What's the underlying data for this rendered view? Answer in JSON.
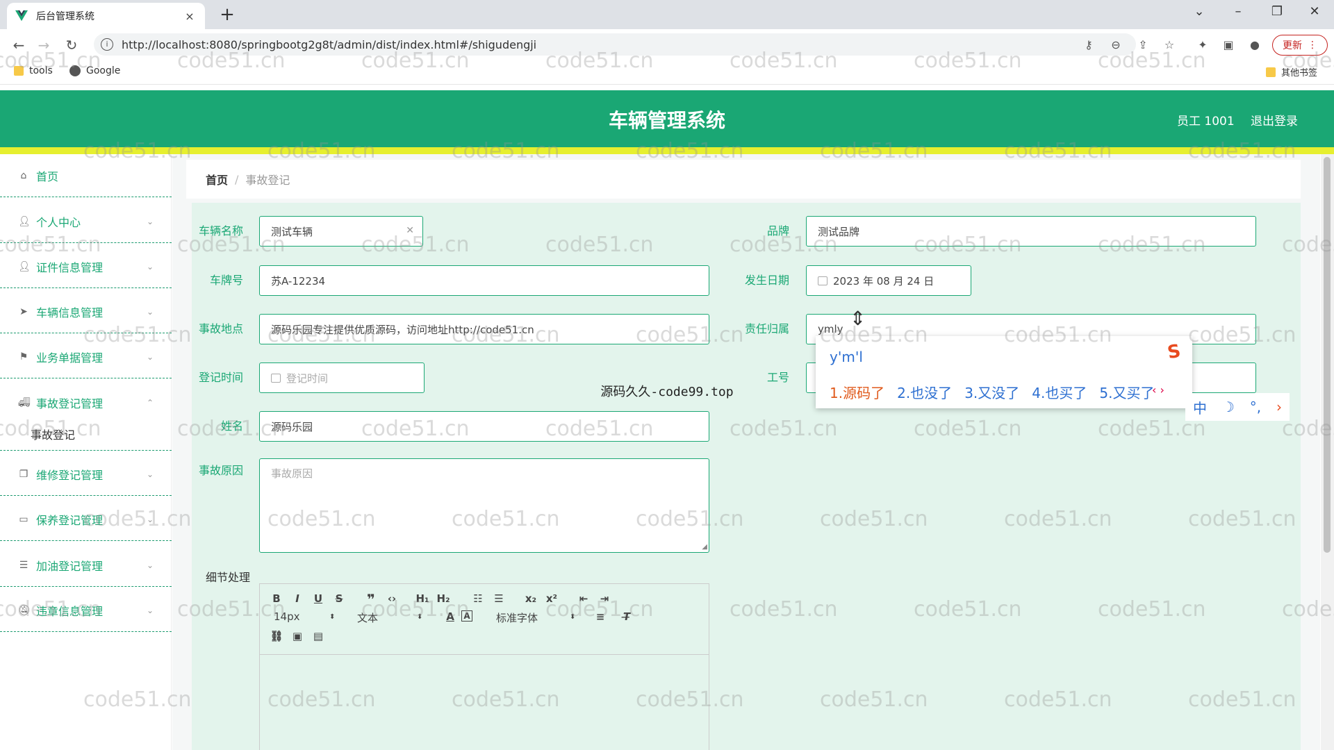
{
  "browser": {
    "tab_title": "后台管理系统",
    "tab_close": "×",
    "new_tab": "+",
    "url": "http://localhost:8080/springbootg2g8t/admin/dist/index.html#/shigudengji",
    "update_label": "更新",
    "bookmarks": [
      "tools",
      "Google"
    ],
    "other_bookmarks": "其他书签"
  },
  "header": {
    "title": "车辆管理系统",
    "user": "员工 1001",
    "logout": "退出登录"
  },
  "sidebar": {
    "items": [
      {
        "label": "首页",
        "icon": "home-icon"
      },
      {
        "label": "个人中心",
        "icon": "user-icon"
      },
      {
        "label": "证件信息管理",
        "icon": "user-icon"
      },
      {
        "label": "车辆信息管理",
        "icon": "send-icon"
      },
      {
        "label": "业务单据管理",
        "icon": "flag-icon"
      },
      {
        "label": "事故登记管理",
        "icon": "truck-icon"
      },
      {
        "label": "维修登记管理",
        "icon": "copy-icon"
      },
      {
        "label": "保养登记管理",
        "icon": "message-icon"
      },
      {
        "label": "加油登记管理",
        "icon": "list-icon"
      },
      {
        "label": "违章信息管理",
        "icon": "bell-off-icon"
      }
    ],
    "submenu": "事故登记"
  },
  "breadcrumb": {
    "home": "首页",
    "sep": "/",
    "current": "事故登记"
  },
  "form": {
    "vehicle_name_label": "车辆名称",
    "vehicle_name_value": "测试车辆",
    "brand_label": "品牌",
    "brand_value": "测试品牌",
    "plate_label": "车牌号",
    "plate_value": "苏A-12234",
    "date_label": "发生日期",
    "date_value": "2023 年 08 月 24 日",
    "location_label": "事故地点",
    "location_value": "源码乐园专注提供优质源码，访问地址http://code51.cn",
    "responsibility_label": "责任归属",
    "responsibility_value": "ymly",
    "register_time_label": "登记时间",
    "register_time_placeholder": "登记时间",
    "staff_no_label": "工号",
    "name_label": "姓名",
    "name_value": "源码乐园",
    "cause_label": "事故原因",
    "cause_placeholder": "事故原因",
    "detail_label": "细节处理"
  },
  "editor": {
    "font_size": "14px",
    "block_type": "文本",
    "font_family": "标准字体"
  },
  "ime": {
    "pinyin": "y'm'l",
    "candidates": [
      "1.源码了",
      "2.也没了",
      "3.又没了",
      "4.也买了",
      "5.又买了"
    ],
    "mode": "中"
  },
  "overlay_text": "源码久久-code99.top",
  "watermark": "code51.cn"
}
